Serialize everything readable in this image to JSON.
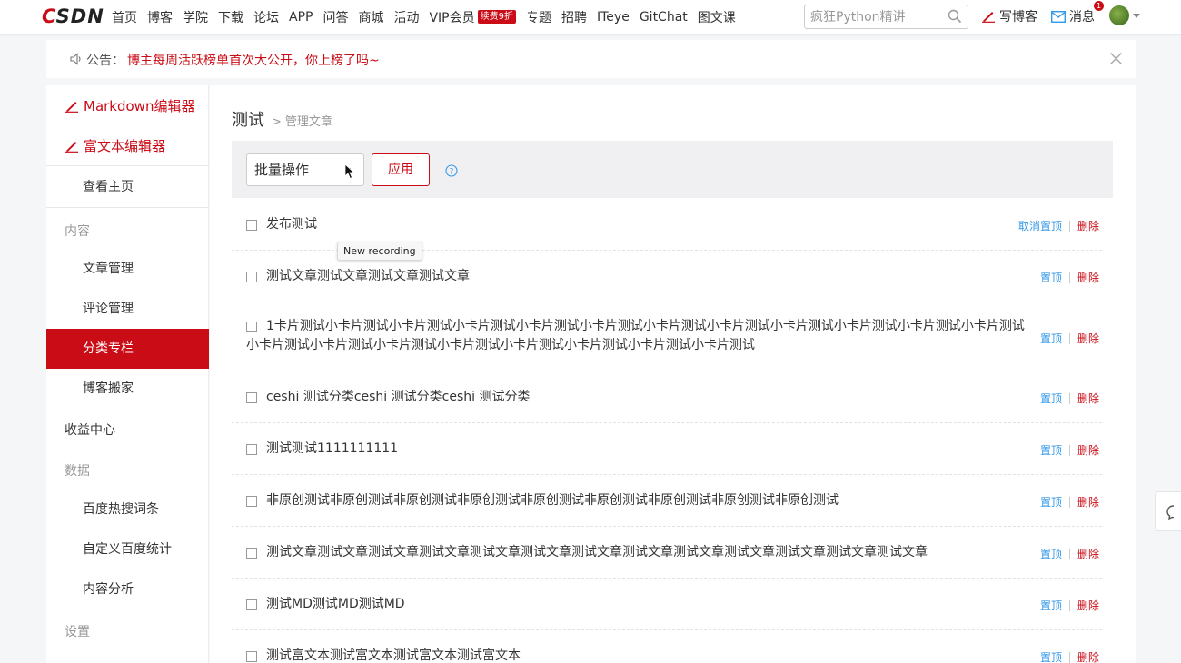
{
  "header": {
    "logo": {
      "c": "C",
      "rest": "SDN"
    },
    "nav": [
      "首页",
      "博客",
      "学院",
      "下载",
      "论坛",
      "APP",
      "问答",
      "商城",
      "活动",
      "VIP会员",
      "专题",
      "招聘",
      "ITeye",
      "GitChat",
      "图文课"
    ],
    "vip_badge": "续费9折",
    "search_placeholder": "疯狂Python精讲",
    "write_blog": "写博客",
    "messages": "消息",
    "message_count": "1"
  },
  "notice": {
    "label": "公告：",
    "text": "博主每周活跃榜单首次大公开，你上榜了吗~"
  },
  "sidebar": {
    "markdown_editor": "Markdown编辑器",
    "rich_editor": "富文本编辑器",
    "view_home": "查看主页",
    "section_content": "内容",
    "article_manage": "文章管理",
    "comment_manage": "评论管理",
    "category_column": "分类专栏",
    "blog_move": "博客搬家",
    "revenue_center": "收益中心",
    "section_data": "数据",
    "baidu_hot": "百度热搜词条",
    "custom_baidu_stats": "自定义百度统计",
    "content_analysis": "内容分析",
    "section_settings": "设置"
  },
  "main": {
    "title": "测试",
    "breadcrumb_sep": ">",
    "breadcrumb_sub": "管理文章",
    "batch_select": "批量操作",
    "apply": "应用",
    "tooltip": "New recording",
    "articles": [
      {
        "title": "发布测试",
        "top_action": "取消置顶",
        "delete": "删除"
      },
      {
        "title": "测试文章测试文章测试文章测试文章",
        "top_action": "置顶",
        "delete": "删除"
      },
      {
        "title": "1卡片测试小卡片测试小卡片测试小卡片测试小卡片测试小卡片测试小卡片测试小卡片测试小卡片测试小卡片测试小卡片测试小卡片测试小卡片测试小卡片测试小卡片测试小卡片测试小卡片测试小卡片测试小卡片测试小卡片测试",
        "top_action": "置顶",
        "delete": "删除"
      },
      {
        "title": "ceshi 测试分类ceshi 测试分类ceshi 测试分类",
        "top_action": "置顶",
        "delete": "删除"
      },
      {
        "title": "测试测试1111111111",
        "top_action": "置顶",
        "delete": "删除"
      },
      {
        "title": "非原创测试非原创测试非原创测试非原创测试非原创测试非原创测试非原创测试非原创测试非原创测试",
        "top_action": "置顶",
        "delete": "删除"
      },
      {
        "title": "测试文章测试文章测试文章测试文章测试文章测试文章测试文章测试文章测试文章测试文章测试文章测试文章测试文章",
        "top_action": "置顶",
        "delete": "删除"
      },
      {
        "title": "测试MD测试MD测试MD",
        "top_action": "置顶",
        "delete": "删除"
      },
      {
        "title": "测试富文本测试富文本测试富文本测试富文本",
        "top_action": "置顶",
        "delete": "删除"
      }
    ]
  },
  "colors": {
    "brand_red": "#ca0c16",
    "link_blue": "#3399ea"
  }
}
